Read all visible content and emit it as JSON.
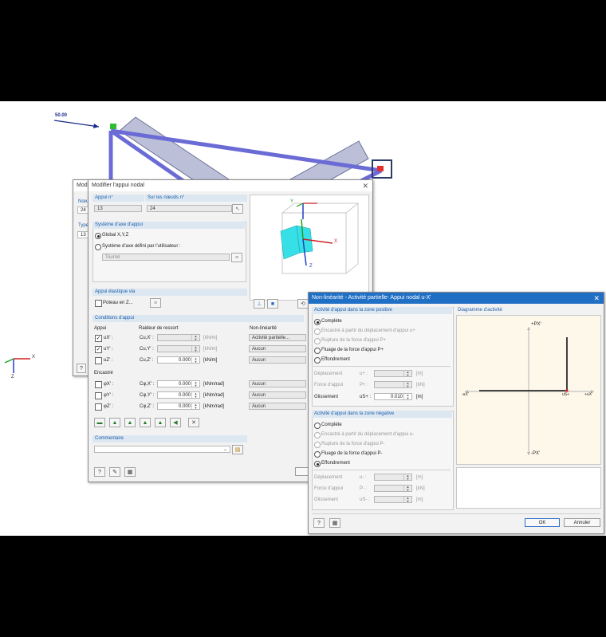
{
  "canvas": {
    "load_label": "50.00",
    "axis_x": "X",
    "axis_z": "Z"
  },
  "back_dialog": {
    "title": "Modi",
    "row1_label": "Nœu",
    "row1_value": "24",
    "row2_label": "Type",
    "row2_value": "13"
  },
  "nodal_support": {
    "title": "Modifier l'appui nodal",
    "support_no_label": "Appui n°",
    "support_no_value": "13",
    "on_nodes_label": "Sur les nœuds n°",
    "on_nodes_value": "24",
    "axis_system": {
      "header": "Système d'axe d'appui",
      "option_global": "Global X,Y,Z",
      "option_user": "Système d'axe défini par l'utilisateur :",
      "user_value": "Tourné"
    },
    "preview_axes": {
      "x": "X",
      "y": "Y",
      "z": "Z"
    },
    "elastic": {
      "header": "Appui élastique via",
      "column_label": "Poteau en Z..."
    },
    "conditions": {
      "header": "Conditions d'appui",
      "col_support": "Appui",
      "col_stiffness": "Raideur de ressort",
      "col_nonlinearity": "Non-linéarité",
      "rows": [
        {
          "label": "uX' :",
          "checked": "✓",
          "stiff_label": "Cu,X' :",
          "value": "",
          "unit": "[kN/m]",
          "nonlin": "Activité partielle..."
        },
        {
          "label": "uY' :",
          "checked": "✓",
          "stiff_label": "Cu,Y' :",
          "value": "",
          "unit": "[kN/m]",
          "nonlin": "Aucun"
        },
        {
          "label": "uZ' :",
          "checked": "",
          "stiff_label": "Cu,Z' :",
          "value": "0.000",
          "unit": "[kN/m]",
          "nonlin": "Aucun"
        }
      ],
      "restraint_label": "Encastré",
      "rot_rows": [
        {
          "label": "φX' :",
          "checked": "",
          "stiff_label": "Cφ,X' :",
          "value": "0.000",
          "unit": "[kNm/rad]",
          "nonlin": "Aucun"
        },
        {
          "label": "φY' :",
          "checked": "",
          "stiff_label": "Cφ,Y' :",
          "value": "0.000",
          "unit": "[kNm/rad]",
          "nonlin": "Aucun"
        },
        {
          "label": "φZ' :",
          "checked": "",
          "stiff_label": "Cφ,Z' :",
          "value": "0.000",
          "unit": "[kNm/rad]",
          "nonlin": "Aucun"
        }
      ]
    },
    "comment_header": "Commentaire"
  },
  "nonlinearity": {
    "title": "Non-linéarité - Activité partielle- Appui nodal u-X'",
    "positive": {
      "header": "Activité d'appui dans la zone positive",
      "options": [
        "Complète",
        "Encastré à partir du déplacement d'appui u+",
        "Rupture de la force d'appui P+",
        "Fluage de la force d'appui P+",
        "Effondrement"
      ],
      "displacement_label": "Déplacement",
      "displacement_sym": "u+ :",
      "force_label": "Force d'appui",
      "force_sym": "P+ :",
      "slip_label": "Glissement",
      "slip_sym": "uS+ :",
      "slip_value": "0.010",
      "unit_m": "[m]",
      "unit_kn": "[kN]"
    },
    "negative": {
      "header": "Activité d'appui dans la zone négative",
      "options": [
        "Complète",
        "Encastré à partir du déplacement d'appui u-",
        "Rupture de la force d'appui P-",
        "Fluage de la force d'appui P-",
        "Effondrement"
      ],
      "displacement_label": "Déplacement",
      "displacement_sym": "u- :",
      "force_label": "Force d'appui",
      "force_sym": "P- :",
      "slip_label": "Glissement",
      "slip_sym": "uS- :",
      "unit_m": "[m]",
      "unit_kn": "[kN]"
    },
    "diagram": {
      "header": "Diagramme d'activité",
      "p_pos": "+PX'",
      "p_neg": "-PX'",
      "u_neg": "-uX'",
      "u_pos": "+uX'",
      "us_label": "uS+"
    },
    "ok_label": "OK",
    "cancel_label": "Annuler"
  }
}
